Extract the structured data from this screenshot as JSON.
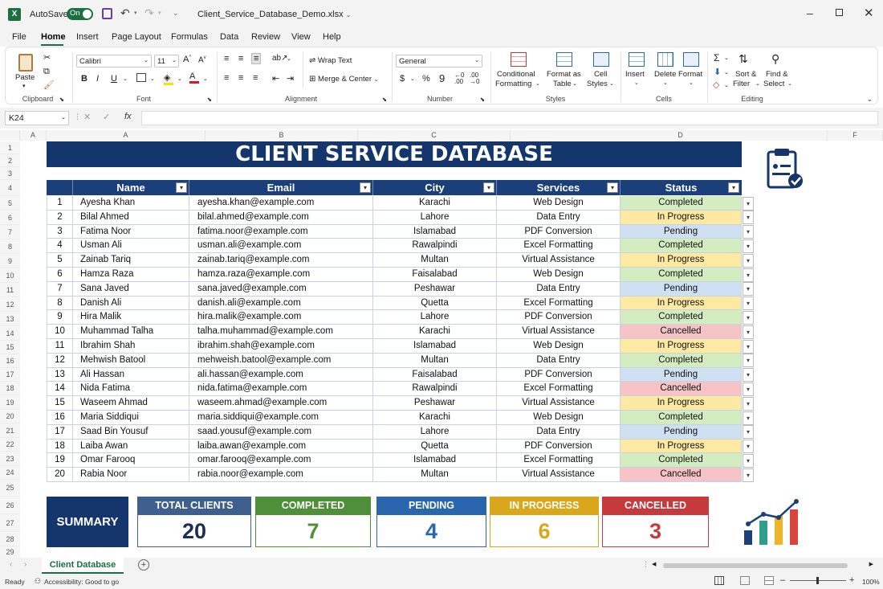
{
  "titlebar": {
    "autosave_label": "AutoSave",
    "autosave_state": "On",
    "filename": "Client_Service_Database_Demo.xlsx"
  },
  "menu": [
    "File",
    "Home",
    "Insert",
    "Page Layout",
    "Formulas",
    "Data",
    "Review",
    "View",
    "Help"
  ],
  "ribbon": {
    "clipboard": {
      "paste": "Paste",
      "label": "Clipboard"
    },
    "font": {
      "name": "Calibri",
      "size": "11",
      "label": "Font"
    },
    "alignment": {
      "wrap": "Wrap Text",
      "merge": "Merge & Center",
      "label": "Alignment"
    },
    "number": {
      "format": "General",
      "label": "Number"
    },
    "styles": {
      "cond1": "Conditional",
      "cond2": "Formatting",
      "fmt1": "Format as",
      "fmt2": "Table",
      "cell1": "Cell",
      "cell2": "Styles",
      "label": "Styles"
    },
    "cells": {
      "insert": "Insert",
      "delete": "Delete",
      "format": "Format",
      "label": "Cells"
    },
    "editing": {
      "sort1": "Sort &",
      "sort2": "Filter",
      "find1": "Find &",
      "find2": "Select",
      "label": "Editing"
    }
  },
  "formula_bar": {
    "name_box": "K24",
    "fx": "fx",
    "value": ""
  },
  "columns": [
    "A",
    "A",
    "B",
    "C",
    "D",
    "E",
    "F"
  ],
  "rows": [
    "1",
    "2",
    "3",
    "4",
    "5",
    "6",
    "7",
    "8",
    "9",
    "10",
    "11",
    "12",
    "13",
    "14",
    "15",
    "16",
    "17",
    "18",
    "19",
    "20",
    "21",
    "22",
    "23",
    "24",
    "25",
    "26",
    "27",
    "28",
    "29"
  ],
  "sheet_title": "CLIENT SERVICE DATABASE",
  "table": {
    "headers": [
      "Name",
      "Email",
      "City",
      "Services",
      "Status"
    ],
    "rows": [
      {
        "n": "1",
        "name": "Ayesha Khan",
        "email": "ayesha.khan@example.com",
        "city": "Karachi",
        "service": "Web Design",
        "status": "Completed"
      },
      {
        "n": "2",
        "name": "Bilal Ahmed",
        "email": "bilal.ahmed@example.com",
        "city": "Lahore",
        "service": "Data Entry",
        "status": "In Progress"
      },
      {
        "n": "3",
        "name": "Fatima Noor",
        "email": "fatima.noor@example.com",
        "city": "Islamabad",
        "service": "PDF Conversion",
        "status": "Pending"
      },
      {
        "n": "4",
        "name": "Usman Ali",
        "email": "usman.ali@example.com",
        "city": "Rawalpindi",
        "service": "Excel Formatting",
        "status": "Completed"
      },
      {
        "n": "5",
        "name": "Zainab Tariq",
        "email": "zainab.tariq@example.com",
        "city": "Multan",
        "service": "Virtual Assistance",
        "status": "In Progress"
      },
      {
        "n": "6",
        "name": "Hamza Raza",
        "email": "hamza.raza@example.com",
        "city": "Faisalabad",
        "service": "Web Design",
        "status": "Completed"
      },
      {
        "n": "7",
        "name": "Sana Javed",
        "email": "sana.javed@example.com",
        "city": "Peshawar",
        "service": "Data Entry",
        "status": "Pending"
      },
      {
        "n": "8",
        "name": "Danish Ali",
        "email": "danish.ali@example.com",
        "city": "Quetta",
        "service": "Excel Formatting",
        "status": "In Progress"
      },
      {
        "n": "9",
        "name": "Hira Malik",
        "email": "hira.malik@example.com",
        "city": "Lahore",
        "service": "PDF Conversion",
        "status": "Completed"
      },
      {
        "n": "10",
        "name": "Muhammad Talha",
        "email": "talha.muhammad@example.com",
        "city": "Karachi",
        "service": "Virtual Assistance",
        "status": "Cancelled"
      },
      {
        "n": "11",
        "name": "Ibrahim Shah",
        "email": "ibrahim.shah@example.com",
        "city": "Islamabad",
        "service": "Web Design",
        "status": "In Progress"
      },
      {
        "n": "12",
        "name": "Mehwish Batool",
        "email": "mehweish.batool@example.com",
        "city": "Multan",
        "service": "Data Entry",
        "status": "Completed"
      },
      {
        "n": "13",
        "name": "Ali Hassan",
        "email": "ali.hassan@example.com",
        "city": "Faisalabad",
        "service": "PDF Conversion",
        "status": "Pending"
      },
      {
        "n": "14",
        "name": "Nida Fatima",
        "email": "nida.fatima@example.com",
        "city": "Rawalpindi",
        "service": "Excel Formatting",
        "status": "Cancelled"
      },
      {
        "n": "15",
        "name": "Waseem Ahmad",
        "email": "waseem.ahmad@example.com",
        "city": "Peshawar",
        "service": "Virtual Assistance",
        "status": "In Progress"
      },
      {
        "n": "16",
        "name": "Maria Siddiqui",
        "email": "maria.siddiqui@example.com",
        "city": "Karachi",
        "service": "Web Design",
        "status": "Completed"
      },
      {
        "n": "17",
        "name": "Saad Bin Yousuf",
        "email": "saad.yousuf@example.com",
        "city": "Lahore",
        "service": "Data Entry",
        "status": "Pending"
      },
      {
        "n": "18",
        "name": "Laiba Awan",
        "email": "laiba.awan@example.com",
        "city": "Quetta",
        "service": "PDF Conversion",
        "status": "In Progress"
      },
      {
        "n": "19",
        "name": "Omar Farooq",
        "email": "omar.farooq@example.com",
        "city": "Islamabad",
        "service": "Excel Formatting",
        "status": "Completed"
      },
      {
        "n": "20",
        "name": "Rabia Noor",
        "email": "rabia.noor@example.com",
        "city": "Multan",
        "service": "Virtual Assistance",
        "status": "Cancelled"
      }
    ]
  },
  "status_colors": {
    "Completed": "#d4edc0",
    "In Progress": "#fde9a2",
    "Pending": "#cfe0f3",
    "Cancelled": "#f6c3c7"
  },
  "summary": {
    "label": "SUMMARY",
    "cards": [
      {
        "title": "TOTAL CLIENTS",
        "value": "20",
        "color": "#3f5f8f",
        "text": "#1b2f55"
      },
      {
        "title": "COMPLETED",
        "value": "7",
        "color": "#4f8f3a",
        "text": "#4f8f3a"
      },
      {
        "title": "PENDING",
        "value": "4",
        "color": "#2a66ad",
        "text": "#2a66ad"
      },
      {
        "title": "IN PROGRESS",
        "value": "6",
        "color": "#d9a61c",
        "text": "#d9a61c"
      },
      {
        "title": "CANCELLED",
        "value": "3",
        "color": "#c63a3d",
        "text": "#c63a3d"
      }
    ]
  },
  "sheet_tab": "Client Database",
  "statusbar": {
    "ready": "Ready",
    "accessibility": "Accessibility: Good to go",
    "zoom": "100%"
  }
}
